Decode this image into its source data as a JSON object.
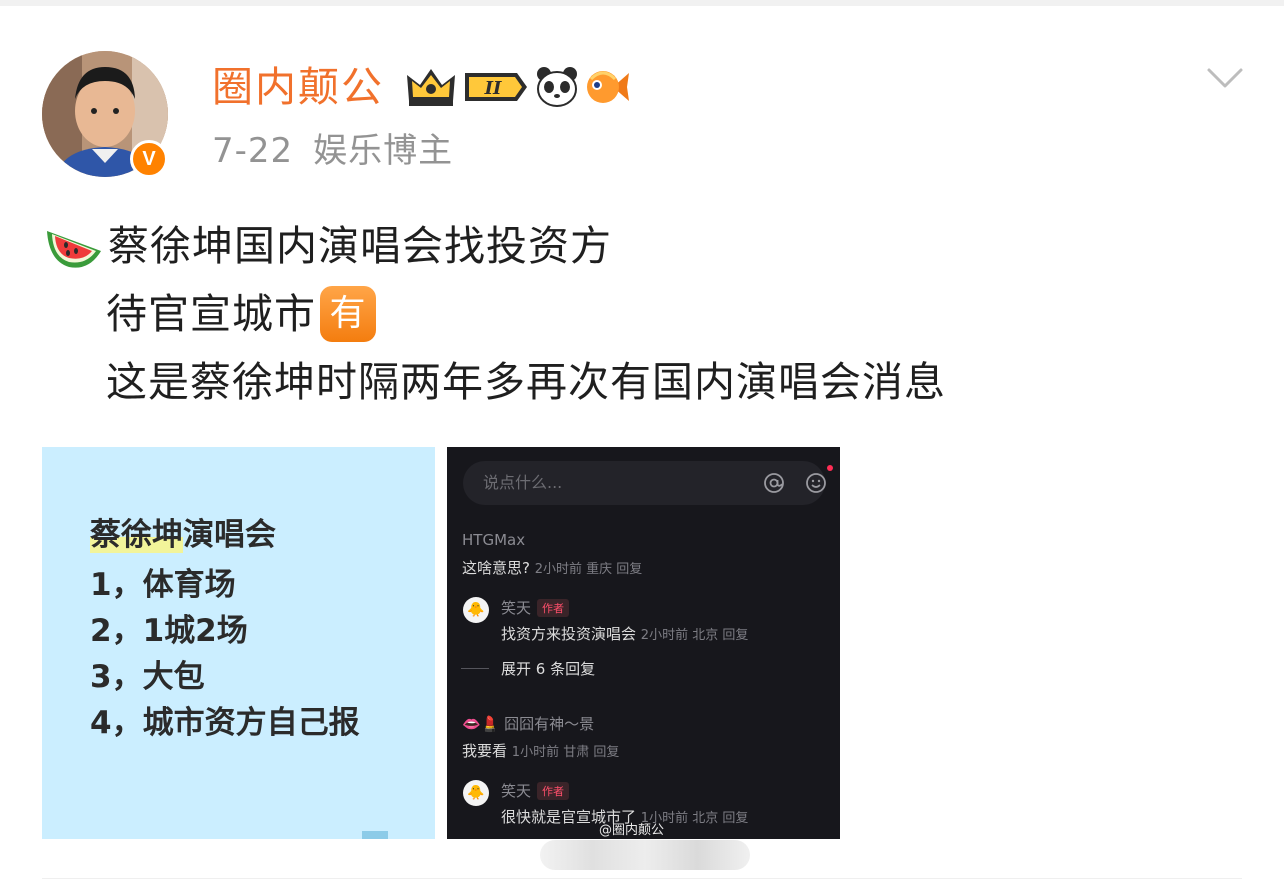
{
  "header": {
    "username": "圈内颠公",
    "verified_badge": "V",
    "membership_badge": "II",
    "badge_icons": [
      "crown-icon",
      "panda-icon",
      "fish-icon"
    ],
    "date": "7-22",
    "category": "娱乐博主",
    "more_icon": "chevron-down-icon"
  },
  "post": {
    "line1_emoji": "watermelon-icon",
    "line1": "蔡徐坤国内演唱会找投资方",
    "line2": "待官宣城市",
    "line2_badge": "有",
    "line3": "这是蔡徐坤时隔两年多再次有国内演唱会消息"
  },
  "image1": {
    "title": "蔡徐坤",
    "title_suffix": "演唱会",
    "items": [
      "1，体育场",
      "2，1城2场",
      "3，大包",
      "4，城市资方自己报"
    ]
  },
  "image2": {
    "input_placeholder": "说点什么...",
    "comments": [
      {
        "user": "HTGMax",
        "text": "这啥意思?",
        "meta": "2小时前 重庆 回复"
      },
      {
        "user": "笑天",
        "tag": "作者",
        "text": "找资方来投资演唱会",
        "meta": "2小时前 北京 回复"
      },
      {
        "expand": "展开 6 条回复"
      },
      {
        "user": "囧囧有神～景",
        "text": "我要看",
        "meta": "1小时前 甘肃 回复"
      },
      {
        "user": "笑天",
        "tag": "作者",
        "text": "很快就是官宣城市了",
        "meta": "1小时前 北京 回复"
      }
    ],
    "watermark": "@圈内颠公"
  },
  "colors": {
    "username": "#f1712c",
    "meta": "#939393",
    "text": "#1f1f1f",
    "image1_bg": "#cbeeff",
    "image2_bg": "#17171c"
  }
}
